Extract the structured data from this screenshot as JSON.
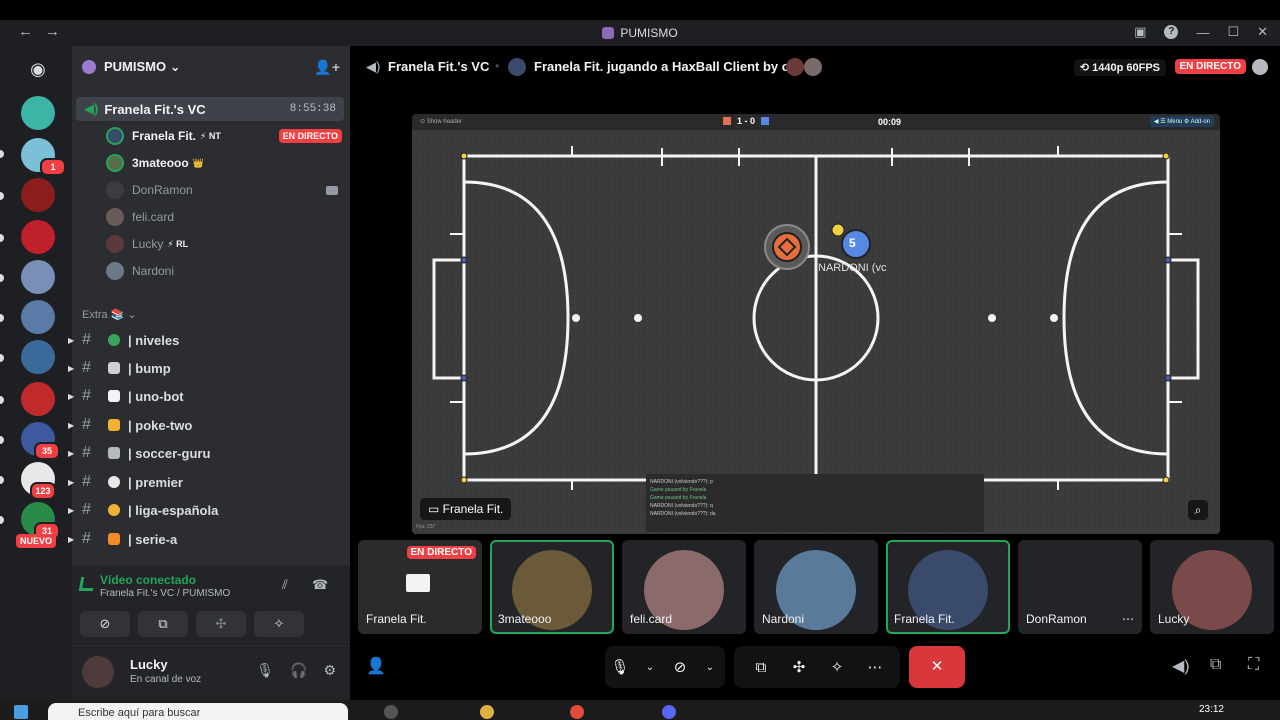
{
  "window": {
    "title": "PUMISMO",
    "back_icon": "arrow-left-icon",
    "forward_icon": "arrow-right-icon"
  },
  "rail": {
    "badges": [
      "1",
      "35",
      "123",
      "31"
    ],
    "new_label": "NUEVO"
  },
  "server": {
    "name": "PUMISMO ⌄"
  },
  "voice_channel": {
    "name": "Franela Fit.'s VC",
    "time": "8:55:38",
    "members": [
      {
        "name": "Franela Fit.",
        "tag": "⚡ NT",
        "live": "EN DIRECTO",
        "active": true
      },
      {
        "name": "3mateooo",
        "tag": "👑",
        "active": true
      },
      {
        "name": "DonRamon",
        "tag": "",
        "active": false
      },
      {
        "name": "feli.card",
        "tag": "",
        "active": false
      },
      {
        "name": "Lucky",
        "tag": "⚡ RL",
        "active": false
      },
      {
        "name": "Nardoni",
        "tag": "",
        "active": false
      }
    ]
  },
  "category": "Extra 📚 ⌄",
  "channels": [
    {
      "name": "| niveles",
      "color": "#3ba55c"
    },
    {
      "name": "| bump",
      "color": "#e9e9e9"
    },
    {
      "name": "| uno-bot",
      "color": "#f2f3f5"
    },
    {
      "name": "| poke-two",
      "color": "#f0b232"
    },
    {
      "name": "| soccer-guru",
      "color": "#b5bac1"
    },
    {
      "name": "| premier",
      "color": "#e9e9e9"
    },
    {
      "name": "| liga-española",
      "color": "#f0b232"
    },
    {
      "name": "| serie-a",
      "color": "#f28c28"
    }
  ],
  "voice_panel": {
    "status": "Vídeo conectado",
    "subtitle": "Franela Fit.'s VC / PUMISMO"
  },
  "user": {
    "name": "Lucky",
    "status": "En canal de voz"
  },
  "stage": {
    "channel": "Franela Fit.'s VC",
    "activity": "Franela Fit. jugando a HaxBall Client by og",
    "quality": "⟲ 1440p 60FPS",
    "live": "EN DIRECTO"
  },
  "stream": {
    "show_header": "⊙ Show header",
    "score": "1 - 0",
    "clock": "00:09",
    "menu": "◀ ☰ Menu  ⚙ Add-on",
    "player_number": "5",
    "player_label": "NARDONI (vc",
    "overlay_name": "Franela Fit.",
    "fps": "Fps: 237",
    "chat_lines": [
      "NARDONI (volviendo???): p",
      "Game paused by Franela",
      "Game paused by Franela",
      "NARDONI (volviendo???): q",
      "NARDONI (volviendo???): da"
    ]
  },
  "tiles": [
    {
      "name": "Franela Fit.",
      "live": "EN DIRECTO"
    },
    {
      "name": "3mateooo"
    },
    {
      "name": "feli.card"
    },
    {
      "name": "Nardoni"
    },
    {
      "name": "Franela Fit."
    },
    {
      "name": "DonRamon"
    },
    {
      "name": "Lucky"
    }
  ],
  "taskbar": {
    "search_placeholder": "Escribe aquí para buscar",
    "time": "23:12"
  },
  "colors": {
    "accent_green": "#23a55a",
    "live_red": "#f23f43",
    "leave_red": "#da373c"
  }
}
